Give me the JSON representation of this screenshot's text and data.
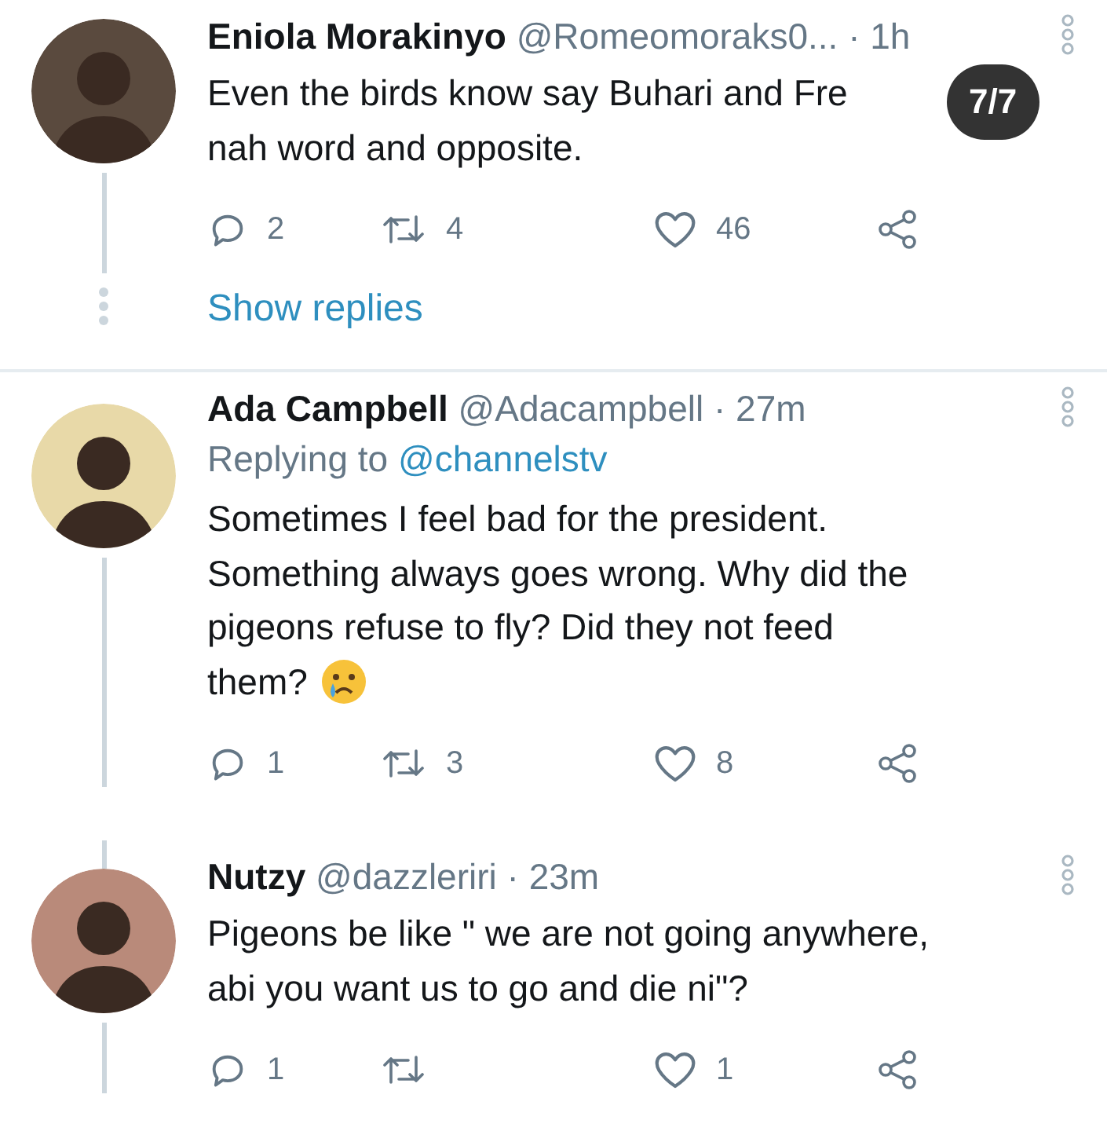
{
  "badge": "7/7",
  "tweets": [
    {
      "name": "Eniola Morakinyo",
      "handle": "@Romeomoraks0...",
      "time": "· 1h",
      "body_lines": [
        "Even the birds know say Buhari and Fre",
        "nah word and opposite."
      ],
      "replies": "2",
      "retweets": "4",
      "likes": "46",
      "show_replies": "Show replies",
      "kind": "collapsed"
    },
    {
      "name": "Ada Campbell",
      "handle": "@Adacampbell",
      "time": "· 27m",
      "replying_prefix": "Replying to",
      "replying_handle": "@channelstv",
      "body_lines": [
        "Sometimes I feel bad for the president.",
        "Something always goes wrong. Why did the",
        "pigeons refuse to fly? Did they not feed",
        "them?"
      ],
      "trailing_emoji": true,
      "replies": "1",
      "retweets": "3",
      "likes": "8",
      "kind": "continues"
    },
    {
      "name": "Nutzy",
      "handle": "@dazzleriri",
      "time": "· 23m",
      "body_lines": [
        "Pigeons be like \" we are not going anywhere,",
        "abi you want us to go and die ni\"?"
      ],
      "replies": "1",
      "likes": "1",
      "kind": "continues"
    }
  ]
}
